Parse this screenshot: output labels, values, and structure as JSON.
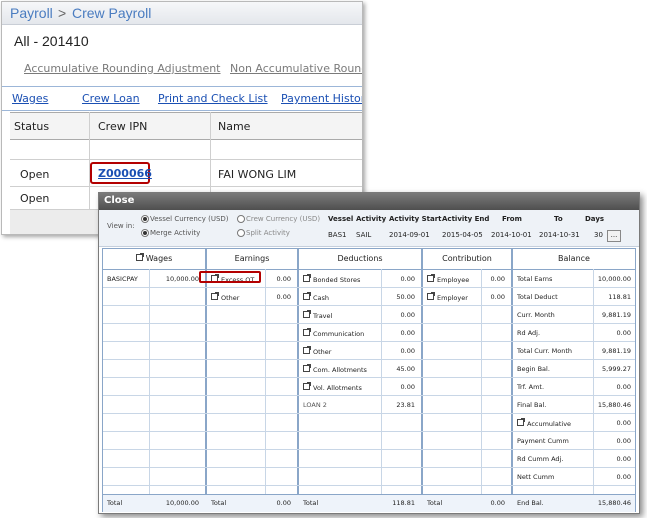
{
  "breadcrumb": {
    "parent": "Payroll",
    "sep": ">",
    "current": "Crew Payroll"
  },
  "subtitle": "All - 201410",
  "links": {
    "accumulative": "Accumulative Rounding Adjustment",
    "non_accumulative": "Non Accumulative Roundi"
  },
  "tabs": [
    "Wages",
    "Crew Loan",
    "Print and Check List",
    "Payment History"
  ],
  "table": {
    "headers": [
      "Status",
      "Crew IPN",
      "Name"
    ],
    "rows": [
      {
        "status": "Open",
        "ipn": "Z000066",
        "name": "FAI WONG LIM"
      },
      {
        "status": "Open",
        "ipn": "",
        "name": ""
      }
    ]
  },
  "dialog": {
    "title": "Close",
    "view_in_label": "View in:",
    "options": {
      "vessel_currency": "Vessel Currency (USD)",
      "crew_currency": "Crew Currency (USD)",
      "merge_activity": "Merge Activity",
      "split_activity": "Split Activity"
    },
    "info_headers": [
      "Vessel",
      "Activity",
      "Activity Start",
      "Activity End",
      "From",
      "To",
      "Days"
    ],
    "info_values": [
      "BAS1",
      "SAIL",
      "2014-09-01",
      "2015-04-05",
      "2014-10-01",
      "2014-10-31",
      "30"
    ],
    "dots_label": "...",
    "sections": {
      "wages": "Wages",
      "earnings": "Earnings",
      "deductions": "Deductions",
      "contribution": "Contribution",
      "balance": "Balance"
    },
    "wages": [
      {
        "label": "BASICPAY",
        "value": "10,000.00"
      }
    ],
    "earnings": [
      {
        "label": "Excess OT",
        "value": "0.00"
      },
      {
        "label": "Other",
        "value": "0.00"
      }
    ],
    "deductions": [
      {
        "label": "Bonded Stores",
        "value": "0.00"
      },
      {
        "label": "Cash",
        "value": "50.00"
      },
      {
        "label": "Travel",
        "value": "0.00"
      },
      {
        "label": "Communication",
        "value": "0.00"
      },
      {
        "label": "Other",
        "value": "0.00"
      },
      {
        "label": "Com. Allotments",
        "value": "45.00"
      },
      {
        "label": "Vol. Allotments",
        "value": "0.00"
      },
      {
        "label": "LOAN 2",
        "value": "23.81"
      }
    ],
    "contribution": [
      {
        "label": "Employee",
        "value": "0.00"
      },
      {
        "label": "Employer",
        "value": "0.00"
      }
    ],
    "balance": [
      {
        "label": "Total Earns",
        "value": "10,000.00"
      },
      {
        "label": "Total Deduct",
        "value": "118.81"
      },
      {
        "label": "Curr. Month",
        "value": "9,881.19"
      },
      {
        "label": "Rd Adj.",
        "value": "0.00"
      },
      {
        "label": "Total Curr. Month",
        "value": "9,881.19"
      },
      {
        "label": "Begin Bal.",
        "value": "5,999.27"
      },
      {
        "label": "Trf. Amt.",
        "value": "0.00"
      },
      {
        "label": "Final Bal.",
        "value": "15,880.46"
      },
      {
        "label": "Accumulative",
        "value": "0.00"
      },
      {
        "label": "Payment Cumm",
        "value": "0.00"
      },
      {
        "label": "Rd Cumm Adj.",
        "value": "0.00"
      },
      {
        "label": "Nett Cumm",
        "value": "0.00"
      }
    ],
    "totals": {
      "label": "Total",
      "wages": "10,000.00",
      "earnings": "0.00",
      "deductions": "118.81",
      "contribution": "0.00",
      "end_label": "End Bal.",
      "end_value": "15,880.46"
    }
  }
}
